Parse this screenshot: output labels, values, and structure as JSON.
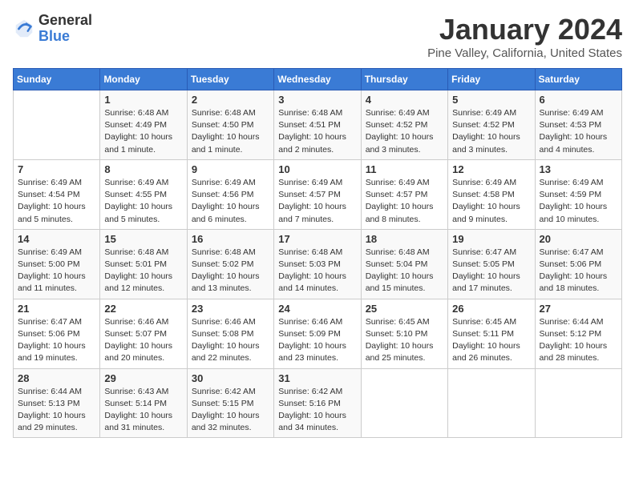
{
  "logo": {
    "general": "General",
    "blue": "Blue"
  },
  "title": "January 2024",
  "subtitle": "Pine Valley, California, United States",
  "header_days": [
    "Sunday",
    "Monday",
    "Tuesday",
    "Wednesday",
    "Thursday",
    "Friday",
    "Saturday"
  ],
  "weeks": [
    [
      {
        "day": "",
        "info": ""
      },
      {
        "day": "1",
        "info": "Sunrise: 6:48 AM\nSunset: 4:49 PM\nDaylight: 10 hours\nand 1 minute."
      },
      {
        "day": "2",
        "info": "Sunrise: 6:48 AM\nSunset: 4:50 PM\nDaylight: 10 hours\nand 1 minute."
      },
      {
        "day": "3",
        "info": "Sunrise: 6:48 AM\nSunset: 4:51 PM\nDaylight: 10 hours\nand 2 minutes."
      },
      {
        "day": "4",
        "info": "Sunrise: 6:49 AM\nSunset: 4:52 PM\nDaylight: 10 hours\nand 3 minutes."
      },
      {
        "day": "5",
        "info": "Sunrise: 6:49 AM\nSunset: 4:52 PM\nDaylight: 10 hours\nand 3 minutes."
      },
      {
        "day": "6",
        "info": "Sunrise: 6:49 AM\nSunset: 4:53 PM\nDaylight: 10 hours\nand 4 minutes."
      }
    ],
    [
      {
        "day": "7",
        "info": "Sunrise: 6:49 AM\nSunset: 4:54 PM\nDaylight: 10 hours\nand 5 minutes."
      },
      {
        "day": "8",
        "info": "Sunrise: 6:49 AM\nSunset: 4:55 PM\nDaylight: 10 hours\nand 5 minutes."
      },
      {
        "day": "9",
        "info": "Sunrise: 6:49 AM\nSunset: 4:56 PM\nDaylight: 10 hours\nand 6 minutes."
      },
      {
        "day": "10",
        "info": "Sunrise: 6:49 AM\nSunset: 4:57 PM\nDaylight: 10 hours\nand 7 minutes."
      },
      {
        "day": "11",
        "info": "Sunrise: 6:49 AM\nSunset: 4:57 PM\nDaylight: 10 hours\nand 8 minutes."
      },
      {
        "day": "12",
        "info": "Sunrise: 6:49 AM\nSunset: 4:58 PM\nDaylight: 10 hours\nand 9 minutes."
      },
      {
        "day": "13",
        "info": "Sunrise: 6:49 AM\nSunset: 4:59 PM\nDaylight: 10 hours\nand 10 minutes."
      }
    ],
    [
      {
        "day": "14",
        "info": "Sunrise: 6:49 AM\nSunset: 5:00 PM\nDaylight: 10 hours\nand 11 minutes."
      },
      {
        "day": "15",
        "info": "Sunrise: 6:48 AM\nSunset: 5:01 PM\nDaylight: 10 hours\nand 12 minutes."
      },
      {
        "day": "16",
        "info": "Sunrise: 6:48 AM\nSunset: 5:02 PM\nDaylight: 10 hours\nand 13 minutes."
      },
      {
        "day": "17",
        "info": "Sunrise: 6:48 AM\nSunset: 5:03 PM\nDaylight: 10 hours\nand 14 minutes."
      },
      {
        "day": "18",
        "info": "Sunrise: 6:48 AM\nSunset: 5:04 PM\nDaylight: 10 hours\nand 15 minutes."
      },
      {
        "day": "19",
        "info": "Sunrise: 6:47 AM\nSunset: 5:05 PM\nDaylight: 10 hours\nand 17 minutes."
      },
      {
        "day": "20",
        "info": "Sunrise: 6:47 AM\nSunset: 5:06 PM\nDaylight: 10 hours\nand 18 minutes."
      }
    ],
    [
      {
        "day": "21",
        "info": "Sunrise: 6:47 AM\nSunset: 5:06 PM\nDaylight: 10 hours\nand 19 minutes."
      },
      {
        "day": "22",
        "info": "Sunrise: 6:46 AM\nSunset: 5:07 PM\nDaylight: 10 hours\nand 20 minutes."
      },
      {
        "day": "23",
        "info": "Sunrise: 6:46 AM\nSunset: 5:08 PM\nDaylight: 10 hours\nand 22 minutes."
      },
      {
        "day": "24",
        "info": "Sunrise: 6:46 AM\nSunset: 5:09 PM\nDaylight: 10 hours\nand 23 minutes."
      },
      {
        "day": "25",
        "info": "Sunrise: 6:45 AM\nSunset: 5:10 PM\nDaylight: 10 hours\nand 25 minutes."
      },
      {
        "day": "26",
        "info": "Sunrise: 6:45 AM\nSunset: 5:11 PM\nDaylight: 10 hours\nand 26 minutes."
      },
      {
        "day": "27",
        "info": "Sunrise: 6:44 AM\nSunset: 5:12 PM\nDaylight: 10 hours\nand 28 minutes."
      }
    ],
    [
      {
        "day": "28",
        "info": "Sunrise: 6:44 AM\nSunset: 5:13 PM\nDaylight: 10 hours\nand 29 minutes."
      },
      {
        "day": "29",
        "info": "Sunrise: 6:43 AM\nSunset: 5:14 PM\nDaylight: 10 hours\nand 31 minutes."
      },
      {
        "day": "30",
        "info": "Sunrise: 6:42 AM\nSunset: 5:15 PM\nDaylight: 10 hours\nand 32 minutes."
      },
      {
        "day": "31",
        "info": "Sunrise: 6:42 AM\nSunset: 5:16 PM\nDaylight: 10 hours\nand 34 minutes."
      },
      {
        "day": "",
        "info": ""
      },
      {
        "day": "",
        "info": ""
      },
      {
        "day": "",
        "info": ""
      }
    ]
  ]
}
